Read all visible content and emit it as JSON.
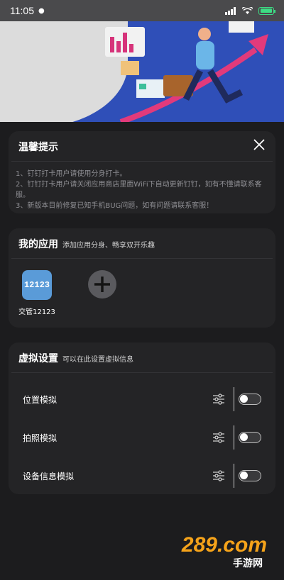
{
  "status": {
    "time": "11:05"
  },
  "tips": {
    "title": "温馨提示",
    "lines": [
      "1、钉钉打卡用户请使用分身打卡。",
      "2、钉钉打卡用户请关闭应用商店里面WiFi下自动更新钉钉，如有不懂请联系客服。",
      "3、新版本目前修复已知手机BUG问题，如有问题请联系客服！"
    ]
  },
  "apps": {
    "title": "我的应用",
    "subtitle": "添加应用分身、畅享双开乐趣",
    "items": [
      {
        "icon_text": "12123",
        "label": "交管12123"
      }
    ]
  },
  "virtual": {
    "title": "虚拟设置",
    "subtitle": "可以在此设置虚拟信息",
    "items": [
      {
        "label": "位置模拟",
        "enabled": false
      },
      {
        "label": "拍照模拟",
        "enabled": false
      },
      {
        "label": "设备信息模拟",
        "enabled": false
      }
    ]
  },
  "watermark": {
    "logo": "289.com",
    "sub": "手游网"
  },
  "colors": {
    "background": "#1c1c1e",
    "card": "#242426",
    "banner": "#2f4fb8",
    "accent": "#f5a31a"
  }
}
